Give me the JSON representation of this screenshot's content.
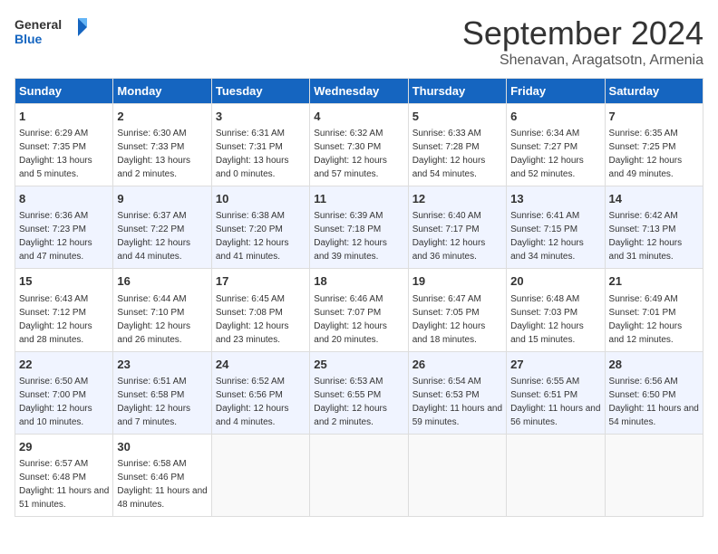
{
  "header": {
    "logo_general": "General",
    "logo_blue": "Blue",
    "month": "September 2024",
    "location": "Shenavan, Aragatsotn, Armenia"
  },
  "weekdays": [
    "Sunday",
    "Monday",
    "Tuesday",
    "Wednesday",
    "Thursday",
    "Friday",
    "Saturday"
  ],
  "weeks": [
    [
      {
        "day": "1",
        "sunrise": "Sunrise: 6:29 AM",
        "sunset": "Sunset: 7:35 PM",
        "daylight": "Daylight: 13 hours and 5 minutes."
      },
      {
        "day": "2",
        "sunrise": "Sunrise: 6:30 AM",
        "sunset": "Sunset: 7:33 PM",
        "daylight": "Daylight: 13 hours and 2 minutes."
      },
      {
        "day": "3",
        "sunrise": "Sunrise: 6:31 AM",
        "sunset": "Sunset: 7:31 PM",
        "daylight": "Daylight: 13 hours and 0 minutes."
      },
      {
        "day": "4",
        "sunrise": "Sunrise: 6:32 AM",
        "sunset": "Sunset: 7:30 PM",
        "daylight": "Daylight: 12 hours and 57 minutes."
      },
      {
        "day": "5",
        "sunrise": "Sunrise: 6:33 AM",
        "sunset": "Sunset: 7:28 PM",
        "daylight": "Daylight: 12 hours and 54 minutes."
      },
      {
        "day": "6",
        "sunrise": "Sunrise: 6:34 AM",
        "sunset": "Sunset: 7:27 PM",
        "daylight": "Daylight: 12 hours and 52 minutes."
      },
      {
        "day": "7",
        "sunrise": "Sunrise: 6:35 AM",
        "sunset": "Sunset: 7:25 PM",
        "daylight": "Daylight: 12 hours and 49 minutes."
      }
    ],
    [
      {
        "day": "8",
        "sunrise": "Sunrise: 6:36 AM",
        "sunset": "Sunset: 7:23 PM",
        "daylight": "Daylight: 12 hours and 47 minutes."
      },
      {
        "day": "9",
        "sunrise": "Sunrise: 6:37 AM",
        "sunset": "Sunset: 7:22 PM",
        "daylight": "Daylight: 12 hours and 44 minutes."
      },
      {
        "day": "10",
        "sunrise": "Sunrise: 6:38 AM",
        "sunset": "Sunset: 7:20 PM",
        "daylight": "Daylight: 12 hours and 41 minutes."
      },
      {
        "day": "11",
        "sunrise": "Sunrise: 6:39 AM",
        "sunset": "Sunset: 7:18 PM",
        "daylight": "Daylight: 12 hours and 39 minutes."
      },
      {
        "day": "12",
        "sunrise": "Sunrise: 6:40 AM",
        "sunset": "Sunset: 7:17 PM",
        "daylight": "Daylight: 12 hours and 36 minutes."
      },
      {
        "day": "13",
        "sunrise": "Sunrise: 6:41 AM",
        "sunset": "Sunset: 7:15 PM",
        "daylight": "Daylight: 12 hours and 34 minutes."
      },
      {
        "day": "14",
        "sunrise": "Sunrise: 6:42 AM",
        "sunset": "Sunset: 7:13 PM",
        "daylight": "Daylight: 12 hours and 31 minutes."
      }
    ],
    [
      {
        "day": "15",
        "sunrise": "Sunrise: 6:43 AM",
        "sunset": "Sunset: 7:12 PM",
        "daylight": "Daylight: 12 hours and 28 minutes."
      },
      {
        "day": "16",
        "sunrise": "Sunrise: 6:44 AM",
        "sunset": "Sunset: 7:10 PM",
        "daylight": "Daylight: 12 hours and 26 minutes."
      },
      {
        "day": "17",
        "sunrise": "Sunrise: 6:45 AM",
        "sunset": "Sunset: 7:08 PM",
        "daylight": "Daylight: 12 hours and 23 minutes."
      },
      {
        "day": "18",
        "sunrise": "Sunrise: 6:46 AM",
        "sunset": "Sunset: 7:07 PM",
        "daylight": "Daylight: 12 hours and 20 minutes."
      },
      {
        "day": "19",
        "sunrise": "Sunrise: 6:47 AM",
        "sunset": "Sunset: 7:05 PM",
        "daylight": "Daylight: 12 hours and 18 minutes."
      },
      {
        "day": "20",
        "sunrise": "Sunrise: 6:48 AM",
        "sunset": "Sunset: 7:03 PM",
        "daylight": "Daylight: 12 hours and 15 minutes."
      },
      {
        "day": "21",
        "sunrise": "Sunrise: 6:49 AM",
        "sunset": "Sunset: 7:01 PM",
        "daylight": "Daylight: 12 hours and 12 minutes."
      }
    ],
    [
      {
        "day": "22",
        "sunrise": "Sunrise: 6:50 AM",
        "sunset": "Sunset: 7:00 PM",
        "daylight": "Daylight: 12 hours and 10 minutes."
      },
      {
        "day": "23",
        "sunrise": "Sunrise: 6:51 AM",
        "sunset": "Sunset: 6:58 PM",
        "daylight": "Daylight: 12 hours and 7 minutes."
      },
      {
        "day": "24",
        "sunrise": "Sunrise: 6:52 AM",
        "sunset": "Sunset: 6:56 PM",
        "daylight": "Daylight: 12 hours and 4 minutes."
      },
      {
        "day": "25",
        "sunrise": "Sunrise: 6:53 AM",
        "sunset": "Sunset: 6:55 PM",
        "daylight": "Daylight: 12 hours and 2 minutes."
      },
      {
        "day": "26",
        "sunrise": "Sunrise: 6:54 AM",
        "sunset": "Sunset: 6:53 PM",
        "daylight": "Daylight: 11 hours and 59 minutes."
      },
      {
        "day": "27",
        "sunrise": "Sunrise: 6:55 AM",
        "sunset": "Sunset: 6:51 PM",
        "daylight": "Daylight: 11 hours and 56 minutes."
      },
      {
        "day": "28",
        "sunrise": "Sunrise: 6:56 AM",
        "sunset": "Sunset: 6:50 PM",
        "daylight": "Daylight: 11 hours and 54 minutes."
      }
    ],
    [
      {
        "day": "29",
        "sunrise": "Sunrise: 6:57 AM",
        "sunset": "Sunset: 6:48 PM",
        "daylight": "Daylight: 11 hours and 51 minutes."
      },
      {
        "day": "30",
        "sunrise": "Sunrise: 6:58 AM",
        "sunset": "Sunset: 6:46 PM",
        "daylight": "Daylight: 11 hours and 48 minutes."
      },
      null,
      null,
      null,
      null,
      null
    ]
  ]
}
